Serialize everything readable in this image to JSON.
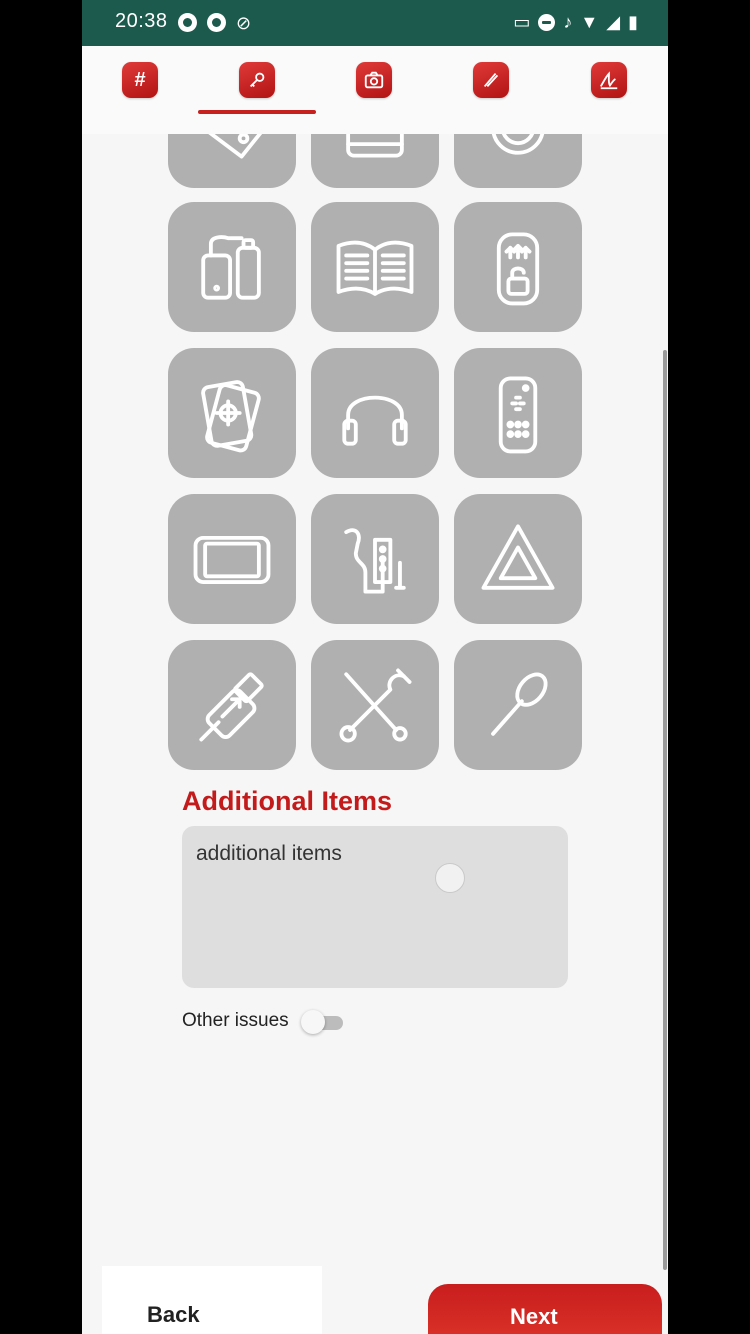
{
  "status_bar": {
    "time": "20:38",
    "left_icons": [
      "spotify-icon",
      "record-icon",
      "eye-off-icon"
    ],
    "right_icons": [
      "cast-icon",
      "dnd-icon",
      "bell-off-icon",
      "wifi-icon",
      "signal-icon",
      "battery-icon"
    ]
  },
  "tabs": [
    {
      "name": "hash-icon",
      "glyph": "#"
    },
    {
      "name": "key-icon",
      "active": true
    },
    {
      "name": "camera-icon"
    },
    {
      "name": "pen-icon"
    },
    {
      "name": "signature-icon"
    }
  ],
  "accessories": [
    "tag-icon",
    "box-icon",
    "ring-icon",
    "charger-icon",
    "manual-icon",
    "lock-device-icon",
    "cards-icon",
    "headphones-icon",
    "remote-icon",
    "tablet-icon",
    "earphones-icon",
    "warning-triangle-icon",
    "usb-cable-icon",
    "tools-icon",
    "pin-tool-icon"
  ],
  "additional": {
    "title": "Additional Items",
    "value": "additional items"
  },
  "other_issues": {
    "label": "Other issues",
    "enabled": false
  },
  "footer": {
    "prev_label": "Back",
    "next_label": "Next"
  },
  "colors": {
    "accent": "#c31b1b",
    "status_bar": "#1d5a4e",
    "tile": "#b0b0b0"
  }
}
